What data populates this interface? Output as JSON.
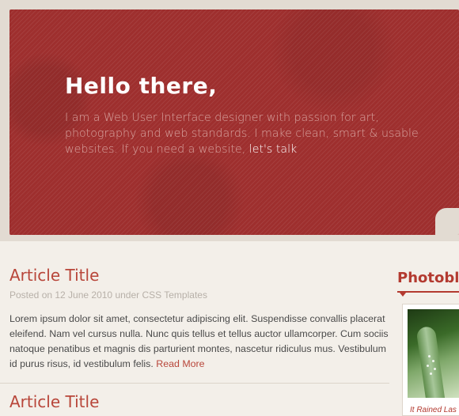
{
  "hero": {
    "title": "Hello there,",
    "text": "I am a Web User Interface designer with passion for art, photography and web standards. I make clean, smart & usable websites. If you need a website, ",
    "link_label": "let's talk"
  },
  "articles": [
    {
      "title": "Article Title",
      "meta": "Posted on 12 June 2010 under CSS Templates",
      "excerpt": "Lorem ipsum dolor sit amet, consectetur adipiscing elit. Suspendisse convallis placerat eleifend. Nam vel cursus nulla. Nunc quis tellus et tellus auctor ullamcorper. Cum sociis natoque penatibus et magnis dis parturient montes, nascetur ridiculus mus. Vestibulum id purus risus, id vestibulum felis. ",
      "read_more": "Read More"
    },
    {
      "title": "Article Title"
    }
  ],
  "sidebar": {
    "title": "Photoblo",
    "photo_caption": "It Rained Las"
  },
  "colors": {
    "hero_red": "#9e2f2e",
    "accent": "#b8463a",
    "background": "#f3efe9"
  }
}
